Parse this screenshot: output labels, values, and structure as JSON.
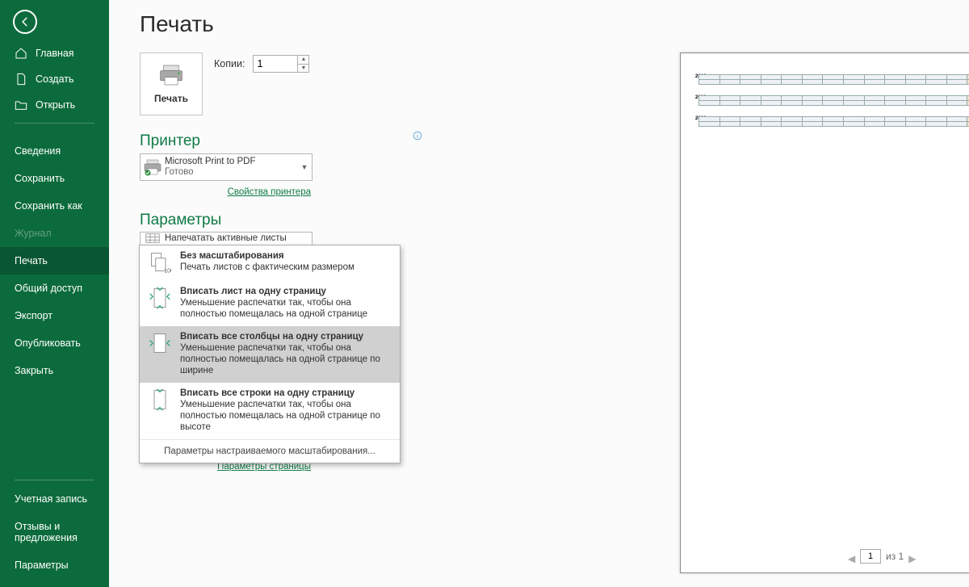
{
  "sidebar": {
    "top": [
      {
        "label": "Главная",
        "name": "nav-home"
      },
      {
        "label": "Создать",
        "name": "nav-new"
      },
      {
        "label": "Открыть",
        "name": "nav-open"
      }
    ],
    "middle": [
      {
        "label": "Сведения",
        "name": "nav-info"
      },
      {
        "label": "Сохранить",
        "name": "nav-save"
      },
      {
        "label": "Сохранить как",
        "name": "nav-save-as"
      },
      {
        "label": "Журнал",
        "name": "nav-history",
        "disabled": true
      },
      {
        "label": "Печать",
        "name": "nav-print",
        "active": true
      },
      {
        "label": "Общий доступ",
        "name": "nav-share"
      },
      {
        "label": "Экспорт",
        "name": "nav-export"
      },
      {
        "label": "Опубликовать",
        "name": "nav-publish"
      },
      {
        "label": "Закрыть",
        "name": "nav-close"
      }
    ],
    "bottom": [
      {
        "label": "Учетная запись",
        "name": "nav-account"
      },
      {
        "label": "Отзывы и предложения",
        "name": "nav-feedback"
      },
      {
        "label": "Параметры",
        "name": "nav-options"
      }
    ]
  },
  "page": {
    "title": "Печать",
    "print_button": "Печать",
    "copies_label": "Копии:",
    "copies_value": "1",
    "printer_heading": "Принтер",
    "printer_name": "Microsoft Print to PDF",
    "printer_status": "Готово",
    "printer_props": "Свойства принтера",
    "settings_heading": "Параметры",
    "active_sheets": "Напечатать активные листы",
    "scaling_dd": {
      "title": "Вписать все столбцы на од...",
      "sub": "Уменьшение распечатки т..."
    },
    "page_setup": "Параметры страницы",
    "page_nav": {
      "current": "1",
      "total_label": "из 1"
    }
  },
  "menu": {
    "items": [
      {
        "title": "Без масштабирования",
        "sub": "Печать листов с фактическим размером"
      },
      {
        "title": "Вписать лист на одну страницу",
        "sub": "Уменьшение распечатки так, чтобы она полностью помещалась на одной странице"
      },
      {
        "title": "Вписать все столбцы на одну страницу",
        "sub": "Уменьшение распечатки так, чтобы она полностью помещалась на одной странице по ширине",
        "hover": true
      },
      {
        "title": "Вписать все строки на одну страницу",
        "sub": "Уменьшение распечатки так, чтобы она полностью помещалась на одной странице по высоте"
      }
    ],
    "footer": "Параметры настраиваемого масштабирования..."
  },
  "preview": {
    "years": [
      "2018",
      "2019",
      "2020"
    ]
  }
}
